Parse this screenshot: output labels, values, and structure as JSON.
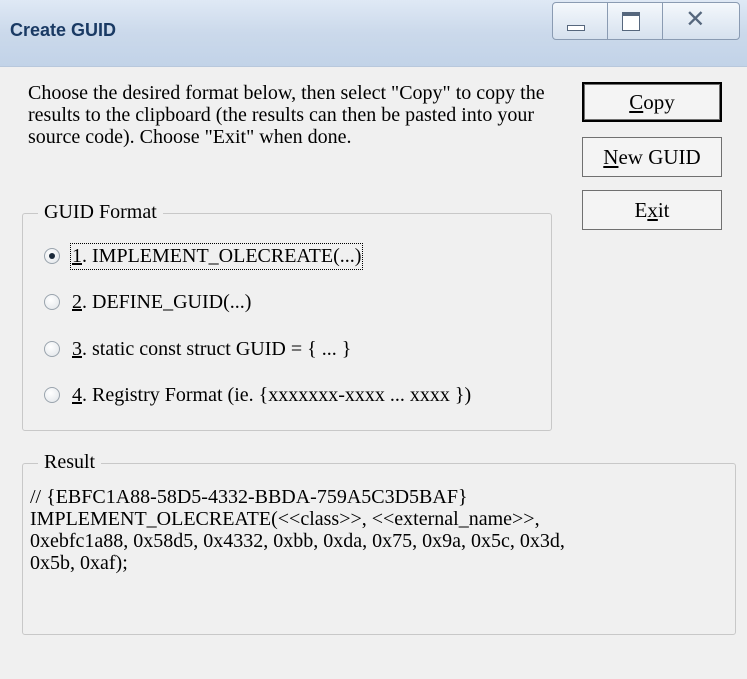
{
  "window": {
    "title": "Create GUID",
    "caption_buttons": [
      "minimize-icon",
      "maximize-icon",
      "close-icon"
    ]
  },
  "description": "Choose the desired format below, then select \"Copy\" to copy the results to the clipboard (the results can then be pasted into your source code).  Choose \"Exit\" when done.",
  "buttons": {
    "copy": {
      "mnemonic": "C",
      "rest": "opy"
    },
    "new_guid": {
      "mnemonic": "N",
      "rest": "ew GUID"
    },
    "exit": {
      "pre": "E",
      "mnemonic": "x",
      "rest": "it"
    }
  },
  "guid_format": {
    "legend": "GUID Format",
    "selected_index": 0,
    "options": [
      {
        "num": "1",
        "rest": ". IMPLEMENT_OLECREATE(...)"
      },
      {
        "num": "2",
        "rest": ". DEFINE_GUID(...)"
      },
      {
        "num": "3",
        "rest": ". static const struct GUID = { ... }"
      },
      {
        "num": "4",
        "rest": ". Registry Format (ie. {xxxxxxx-xxxx ... xxxx })"
      }
    ]
  },
  "result": {
    "legend": "Result",
    "text": "// {EBFC1A88-58D5-4332-BBDA-759A5C3D5BAF}\nIMPLEMENT_OLECREATE(<<class>>, <<external_name>>,\n0xebfc1a88, 0x58d5, 0x4332, 0xbb, 0xda, 0x75, 0x9a, 0x5c, 0x3d,\n0x5b, 0xaf);"
  }
}
